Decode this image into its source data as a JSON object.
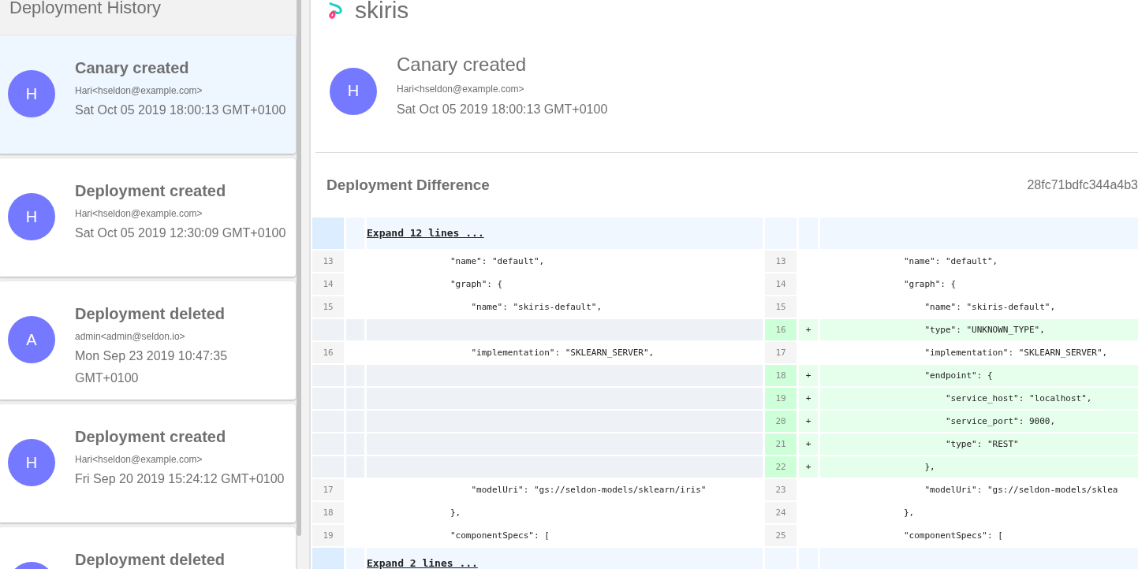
{
  "history": {
    "title": "Deployment History",
    "items": [
      {
        "title": "Canary created",
        "author": "Hari<hseldon@example.com>",
        "date": "Sat Oct 05 2019 18:00:13 GMT+0100",
        "initial": "H",
        "selected": true
      },
      {
        "title": "Deployment created",
        "author": "Hari<hseldon@example.com>",
        "date": "Sat Oct 05 2019 12:30:09 GMT+0100",
        "initial": "H",
        "selected": false
      },
      {
        "title": "Deployment deleted",
        "author": "admin<admin@seldon.io>",
        "date": "Mon Sep 23 2019 10:47:35 GMT+0100",
        "initial": "A",
        "selected": false
      },
      {
        "title": "Deployment created",
        "author": "Hari<hseldon@example.com>",
        "date": "Fri Sep 20 2019 15:24:12 GMT+0100",
        "initial": "H",
        "selected": false
      },
      {
        "title": "Deployment deleted",
        "selected": false
      }
    ]
  },
  "deployment": {
    "name": "skiris",
    "event": {
      "initial": "H",
      "title": "Canary created",
      "author": "Hari<hseldon@example.com>",
      "date": "Sat Oct 05 2019 18:00:13 GMT+0100"
    }
  },
  "diff": {
    "title": "Deployment Difference",
    "hash": "28fc71bdfc344a4b3",
    "rows": [
      {
        "kind": "expand",
        "label": "Expand 12 lines ..."
      },
      {
        "kind": "line",
        "left_num": "13",
        "left": "                \"name\": \"default\",",
        "right_num": "13",
        "right": "                \"name\": \"default\",",
        "added": false
      },
      {
        "kind": "line",
        "left_num": "14",
        "left": "                \"graph\": {",
        "right_num": "14",
        "right": "                \"graph\": {",
        "added": false
      },
      {
        "kind": "line",
        "left_num": "15",
        "left": "                    \"name\": \"skiris-default\",",
        "right_num": "15",
        "right": "                    \"name\": \"skiris-default\",",
        "added": false
      },
      {
        "kind": "line",
        "right_num": "16",
        "right": "                    \"type\": \"UNKNOWN_TYPE\",",
        "added": true,
        "marker": "+"
      },
      {
        "kind": "line",
        "left_num": "16",
        "left": "                    \"implementation\": \"SKLEARN_SERVER\",",
        "right_num": "17",
        "right": "                    \"implementation\": \"SKLEARN_SERVER\",",
        "added": false
      },
      {
        "kind": "line",
        "right_num": "18",
        "right": "                    \"endpoint\": {",
        "added": true,
        "marker": "+"
      },
      {
        "kind": "line",
        "right_num": "19",
        "right": "                        \"service_host\": \"localhost\",",
        "added": true,
        "marker": "+"
      },
      {
        "kind": "line",
        "right_num": "20",
        "right": "                        \"service_port\": 9000,",
        "added": true,
        "marker": "+"
      },
      {
        "kind": "line",
        "right_num": "21",
        "right": "                        \"type\": \"REST\"",
        "added": true,
        "marker": "+"
      },
      {
        "kind": "line",
        "right_num": "22",
        "right": "                    },",
        "added": true,
        "marker": "+"
      },
      {
        "kind": "line",
        "left_num": "17",
        "left": "                    \"modelUri\": \"gs://seldon-models/sklearn/iris\"",
        "right_num": "23",
        "right": "                    \"modelUri\": \"gs://seldon-models/sklea",
        "added": false
      },
      {
        "kind": "line",
        "left_num": "18",
        "left": "                },",
        "right_num": "24",
        "right": "                },",
        "added": false
      },
      {
        "kind": "line",
        "left_num": "19",
        "left": "                \"componentSpecs\": [",
        "right_num": "25",
        "right": "                \"componentSpecs\": [",
        "added": false
      },
      {
        "kind": "expand",
        "label": "Expand 2 lines ..."
      }
    ]
  }
}
